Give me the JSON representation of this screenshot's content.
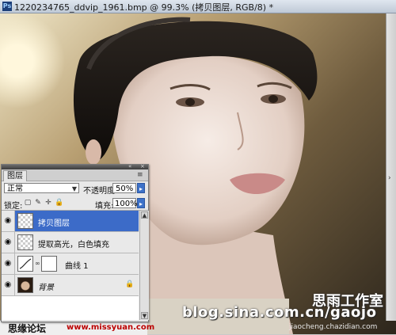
{
  "window": {
    "title": "1220234765_ddvip_1961.bmp @ 99.3% (拷贝图层, RGB/8) *"
  },
  "layers_panel": {
    "tab": "图层",
    "blend_mode": "正常",
    "opacity_label": "不透明度:",
    "opacity_value": "50%",
    "lock_label": "锁定:",
    "fill_label": "填充:",
    "fill_value": "100%",
    "layers": [
      {
        "name": "拷贝图层",
        "selected": true,
        "visible": true
      },
      {
        "name": "提取高光，白色填充",
        "selected": false,
        "visible": true
      },
      {
        "name": "曲线 1",
        "selected": false,
        "visible": true
      },
      {
        "name": "背景",
        "selected": false,
        "visible": true,
        "locked": true
      }
    ]
  },
  "watermarks": {
    "blog": "blog.sina.com.cn/gaojo",
    "studio": "思雨工作室",
    "small": "jiaocheng.chazidian.com",
    "forum": "思缘论坛",
    "forum_url": "www.missyuan.com"
  },
  "icons": [
    "photoshop-icon",
    "eye-icon",
    "chain-icon",
    "lock-icon",
    "brush-lock-icon",
    "move-lock-icon",
    "transparency-lock-icon",
    "panel-menu-icon"
  ],
  "colors": {
    "selection": "#3c6bc8",
    "panel_bg": "#e8e8e8"
  }
}
